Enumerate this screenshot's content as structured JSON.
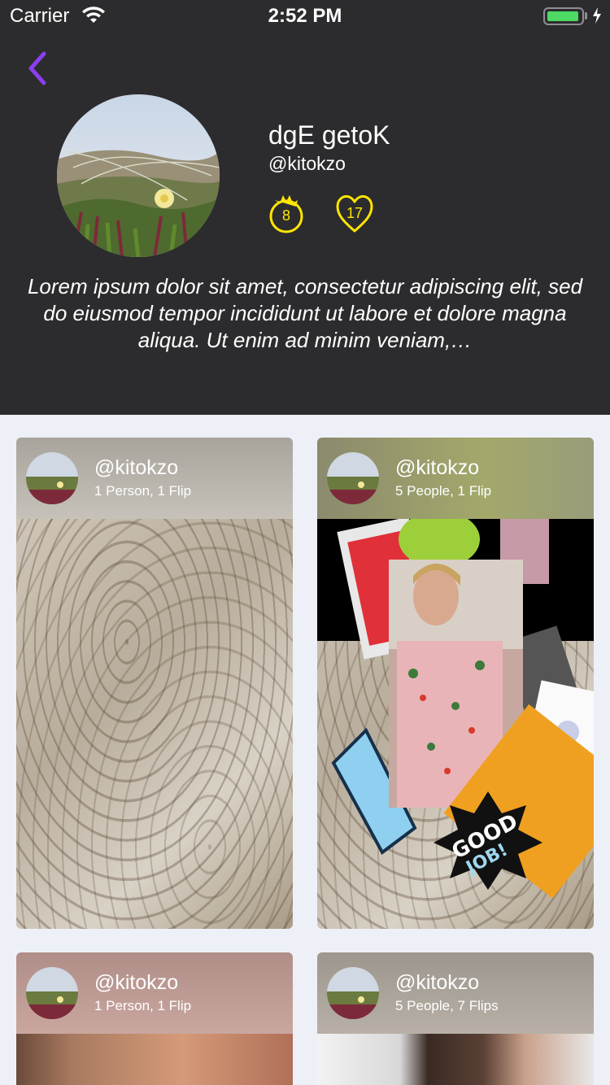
{
  "status_bar": {
    "carrier": "Carrier",
    "time": "2:52 PM"
  },
  "profile": {
    "name": "dgE getoK",
    "handle": "@kitokzo",
    "badges": {
      "sun_count": "8",
      "heart_count": "17"
    },
    "bio": "Lorem ipsum dolor sit amet, consectetur adipiscing elit, sed do eiusmod tempor incididunt ut labore et dolore magna aliqua. Ut enim ad minim veniam,…"
  },
  "cards": [
    {
      "handle": "@kitokzo",
      "meta": "1 Person, 1 Flip"
    },
    {
      "handle": "@kitokzo",
      "meta": "5 People, 1 Flip"
    },
    {
      "handle": "@kitokzo",
      "meta": "1 Person, 1 Flip"
    },
    {
      "handle": "@kitokzo",
      "meta": "5 People, 7 Flips"
    }
  ],
  "colors": {
    "header_bg": "#2c2c2e",
    "page_bg": "#eef0f8",
    "accent_back": "#8a3ff0",
    "badge_yellow": "#ffe600"
  },
  "icons": [
    "back-chevron-icon",
    "wifi-icon",
    "battery-icon",
    "sun-badge-icon",
    "heart-badge-icon"
  ]
}
